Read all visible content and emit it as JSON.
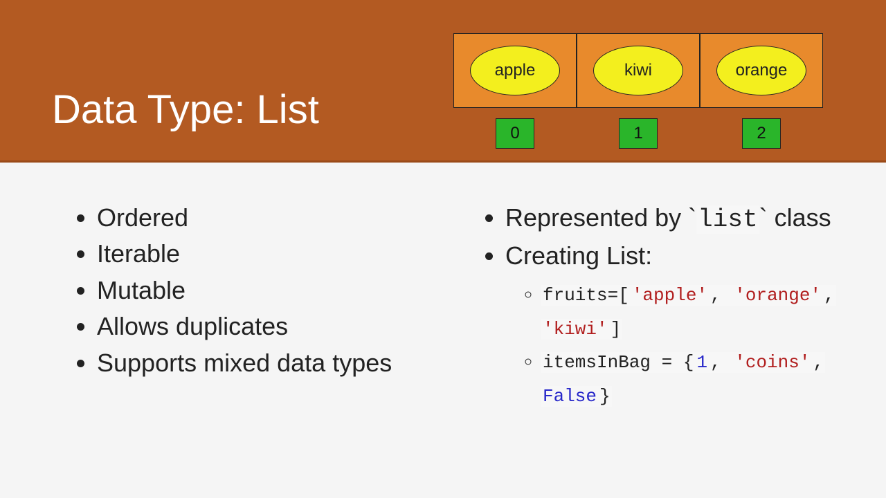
{
  "title": "Data Type: List",
  "diagram": {
    "items": [
      "apple",
      "kiwi",
      "orange"
    ],
    "indices": [
      "0",
      "1",
      "2"
    ]
  },
  "left_bullets": [
    "Ordered",
    "Iterable",
    "Mutable",
    "Allows duplicates",
    "Supports mixed data types"
  ],
  "right": {
    "bullet1_prefix": "Represented by `",
    "bullet1_code": "list",
    "bullet1_suffix": "` class",
    "bullet2": "Creating List:",
    "ex1": {
      "p1": "fruits=[",
      "s1": "'apple'",
      "c1": ", ",
      "s2": "'orange'",
      "c2": ", ",
      "s3": "'kiwi'",
      "p2": "]"
    },
    "ex2": {
      "p1": "itemsInBag = {",
      "n1": "1",
      "c1": ", ",
      "s1": "'coins'",
      "c2": ", ",
      "k1": "False",
      "p2": "}"
    }
  }
}
